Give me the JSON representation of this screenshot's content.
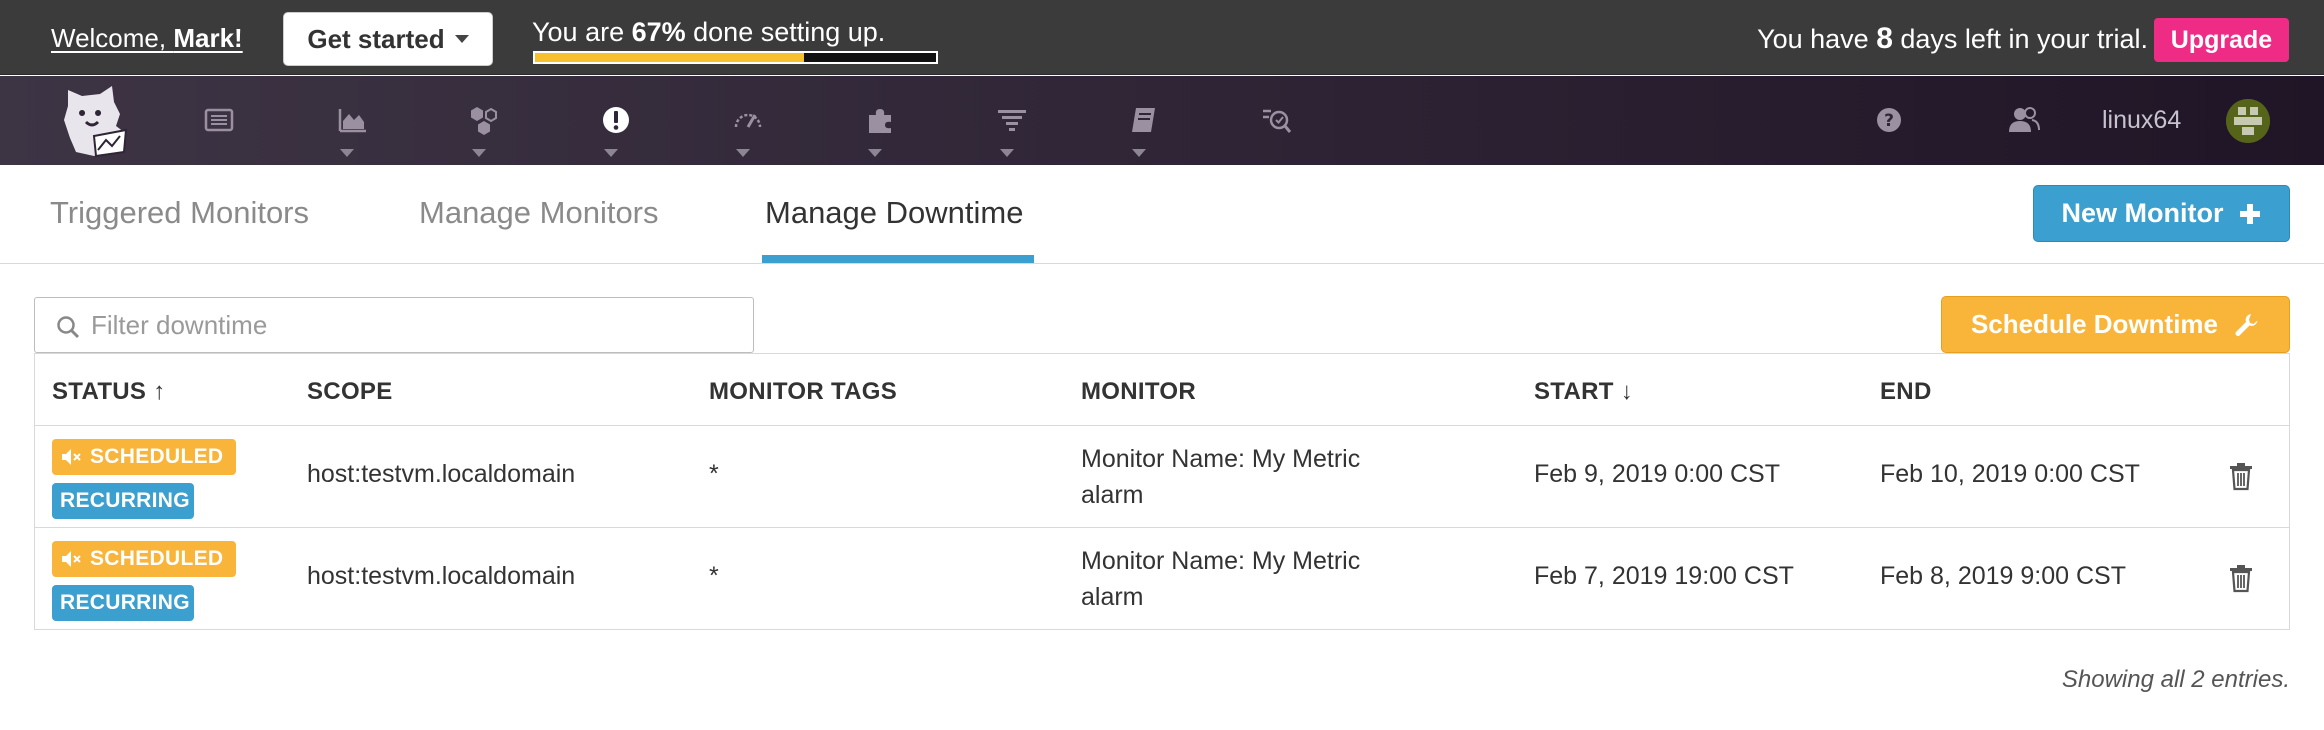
{
  "setup_bar": {
    "welcome_prefix": "Welcome, ",
    "welcome_name": "Mark!",
    "get_started_label": "Get started",
    "progress_prefix": "You are ",
    "progress_percent_text": "67%",
    "progress_suffix": " done setting up.",
    "progress_value": 0.67,
    "trial_prefix": "You have ",
    "trial_days": "8",
    "trial_suffix": " days left in your trial.",
    "upgrade_label": "Upgrade"
  },
  "nav": {
    "items": [
      {
        "icon": "dashboard-list-icon",
        "has_dropdown": false
      },
      {
        "icon": "metrics-area-chart-icon",
        "has_dropdown": true
      },
      {
        "icon": "infrastructure-hexagons-icon",
        "has_dropdown": true
      },
      {
        "icon": "monitors-alert-icon",
        "has_dropdown": true,
        "active": true
      },
      {
        "icon": "apm-gauge-icon",
        "has_dropdown": true
      },
      {
        "icon": "integrations-puzzle-icon",
        "has_dropdown": true
      },
      {
        "icon": "logs-filter-icon",
        "has_dropdown": true
      },
      {
        "icon": "notebooks-book-icon",
        "has_dropdown": true
      },
      {
        "icon": "synthetics-watchdog-icon",
        "has_dropdown": false
      }
    ],
    "help_icon": "question-circle-icon",
    "team_icon": "users-icon",
    "username": "linux64",
    "avatar_icon": "user-avatar"
  },
  "tabs": [
    {
      "label": "Triggered Monitors",
      "active": false
    },
    {
      "label": "Manage Monitors",
      "active": false
    },
    {
      "label": "Manage Downtime",
      "active": true
    }
  ],
  "new_monitor_label": "New Monitor",
  "filter": {
    "placeholder": "Filter downtime",
    "value": ""
  },
  "schedule_downtime_label": "Schedule Downtime",
  "table": {
    "headers": {
      "status": "STATUS",
      "status_sort": "↑",
      "scope": "SCOPE",
      "monitor_tags": "MONITOR TAGS",
      "monitor": "MONITOR",
      "start": "START",
      "start_sort": "↓",
      "end": "END"
    },
    "rows": [
      {
        "status": "SCHEDULED",
        "recurrence": "RECURRING",
        "scope": "host:testvm.localdomain",
        "monitor_tags": "*",
        "monitor": "Monitor Name: My Metric alarm",
        "start": "Feb 9, 2019 0:00 CST",
        "end": "Feb 10, 2019 0:00 CST"
      },
      {
        "status": "SCHEDULED",
        "recurrence": "RECURRING",
        "scope": "host:testvm.localdomain",
        "monitor_tags": "*",
        "monitor": "Monitor Name: My Metric alarm",
        "start": "Feb 7, 2019 19:00 CST",
        "end": "Feb 8, 2019 9:00 CST"
      }
    ]
  },
  "footer_note": "Showing all 2 entries.",
  "colors": {
    "accent_blue": "#3b9fd0",
    "accent_orange": "#f9b43a",
    "upgrade_pink": "#ee2c86",
    "progress_yellow": "#f7c02e"
  }
}
